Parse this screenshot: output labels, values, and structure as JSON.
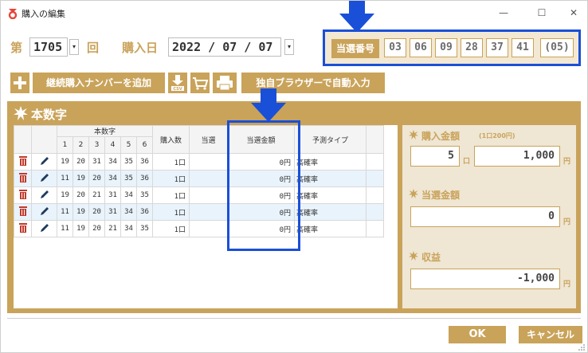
{
  "window": {
    "title": "購入の編集",
    "minimize": "—",
    "maximize": "☐",
    "close": "✕"
  },
  "header": {
    "dai_label": "第",
    "round_value": "1705",
    "kai_label": "回",
    "date_label": "購入日",
    "date_value": "2022 / 07 / 07",
    "dropdown_arrow": "▾"
  },
  "winning": {
    "label": "当選番号",
    "numbers": [
      "03",
      "06",
      "09",
      "28",
      "37",
      "41"
    ],
    "bonus": "(05)"
  },
  "toolbar": {
    "add_continue_label": "継続購入ナンバーを追加",
    "browser_input_label": "独自ブラウザーで自動入力",
    "csv_label": "CSV"
  },
  "panel": {
    "title": "本数字"
  },
  "table": {
    "group_header": "本数字",
    "num_headers": [
      "1",
      "2",
      "3",
      "4",
      "5",
      "6"
    ],
    "col_count": "購入数",
    "col_win": "当選",
    "col_amount": "当選金額",
    "col_type": "予測タイプ",
    "rows": [
      {
        "nums": [
          "19",
          "20",
          "31",
          "34",
          "35",
          "36"
        ],
        "count": "1口",
        "win": "",
        "amount": "0円",
        "type": "高確率"
      },
      {
        "nums": [
          "11",
          "19",
          "20",
          "34",
          "35",
          "36"
        ],
        "count": "1口",
        "win": "",
        "amount": "0円",
        "type": "高確率"
      },
      {
        "nums": [
          "19",
          "20",
          "21",
          "31",
          "34",
          "35"
        ],
        "count": "1口",
        "win": "",
        "amount": "0円",
        "type": "高確率"
      },
      {
        "nums": [
          "11",
          "19",
          "20",
          "31",
          "34",
          "36"
        ],
        "count": "1口",
        "win": "",
        "amount": "0円",
        "type": "高確率"
      },
      {
        "nums": [
          "11",
          "19",
          "20",
          "21",
          "34",
          "35"
        ],
        "count": "1口",
        "win": "",
        "amount": "0円",
        "type": "高確率"
      }
    ]
  },
  "summary": {
    "purchase_label": "購入金額",
    "purchase_note": "(1口200円)",
    "purchase_count": "5",
    "purchase_count_unit": "口",
    "purchase_amount": "1,000",
    "yen": "円",
    "win_label": "当選金額",
    "win_amount": "0",
    "profit_label": "収益",
    "profit_amount": "-1,000"
  },
  "footer": {
    "ok_label": "OK",
    "cancel_label": "キャンセル"
  },
  "colors": {
    "accent": "#c9a35a",
    "highlight": "#1a4fd8",
    "row_alt": "#e9f3fb",
    "delete": "#c0392b"
  }
}
